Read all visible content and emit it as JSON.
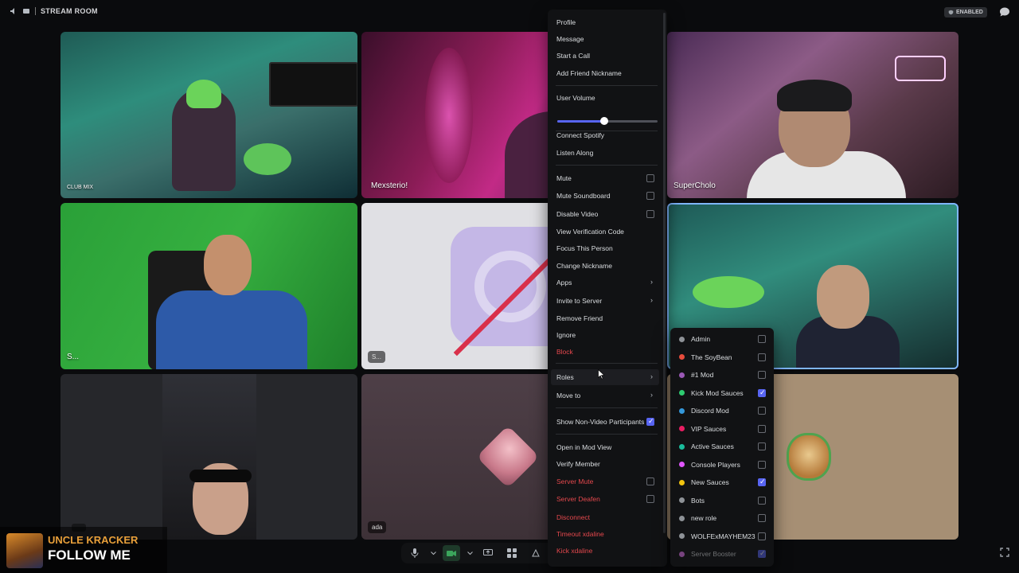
{
  "topbar": {
    "title": "STREAM ROOM",
    "enabled_badge": "ENABLED"
  },
  "tiles": {
    "t1": {
      "overlay": "CLUB MIX"
    },
    "t2": {
      "name": "Mexsterio!"
    },
    "t3": {
      "name": "SuperCholo"
    },
    "t4": {
      "name": "S..."
    },
    "t5": {
      "name": "S..."
    },
    "t8": {
      "name": "ada"
    }
  },
  "now_playing": {
    "artist": "UNCLE KRACKER",
    "song": "FOLLOW ME"
  },
  "context_menu": {
    "profile": "Profile",
    "message": "Message",
    "start_call": "Start a Call",
    "add_nickname": "Add Friend Nickname",
    "user_volume": "User Volume",
    "user_volume_fraction": 0.47,
    "connect_spotify": "Connect Spotify",
    "listen_along": "Listen Along",
    "mute": "Mute",
    "mute_soundboard": "Mute Soundboard",
    "disable_video": "Disable Video",
    "view_verification": "View Verification Code",
    "focus_person": "Focus This Person",
    "change_nickname": "Change Nickname",
    "apps": "Apps",
    "invite_server": "Invite to Server",
    "remove_friend": "Remove Friend",
    "ignore": "Ignore",
    "block": "Block",
    "roles": "Roles",
    "move_to": "Move to",
    "show_non_video": "Show Non-Video Participants",
    "open_mod_view": "Open in Mod View",
    "verify_member": "Verify Member",
    "server_mute": "Server Mute",
    "server_deafen": "Server Deafen",
    "disconnect": "Disconnect",
    "timeout": "Timeout xdaline",
    "kick": "Kick xdaline"
  },
  "roles": [
    {
      "label": "Admin",
      "color": "#8e9297",
      "checked": false
    },
    {
      "label": "The SoyBean",
      "color": "#e74c3c",
      "checked": false
    },
    {
      "label": "#1 Mod",
      "color": "#9b59b6",
      "checked": false
    },
    {
      "label": "Kick Mod Sauces",
      "color": "#2ecc71",
      "checked": true
    },
    {
      "label": "Discord Mod",
      "color": "#3498db",
      "checked": false
    },
    {
      "label": "VIP Sauces",
      "color": "#e91e63",
      "checked": false
    },
    {
      "label": "Active Sauces",
      "color": "#1abc9c",
      "checked": false
    },
    {
      "label": "Console Players",
      "color": "#e056fd",
      "checked": false
    },
    {
      "label": "New Sauces",
      "color": "#f1c40f",
      "checked": true
    },
    {
      "label": "Bots",
      "color": "#8e9297",
      "checked": false
    },
    {
      "label": "new role",
      "color": "#8e9297",
      "checked": false
    },
    {
      "label": "WOLFExMAYHEM23",
      "color": "#8e9297",
      "checked": false
    },
    {
      "label": "Server Booster",
      "color": "#f47fff",
      "checked": true
    }
  ]
}
